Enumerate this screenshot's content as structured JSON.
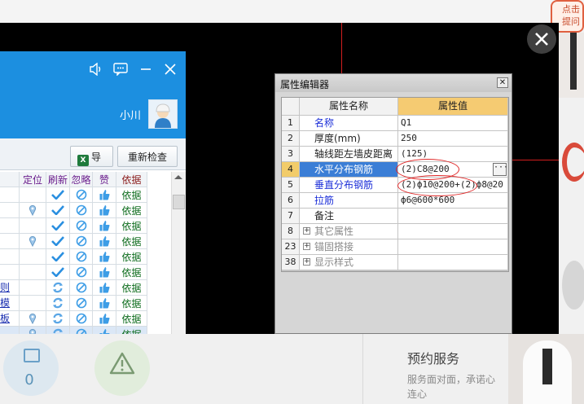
{
  "background_page": {
    "callout_text": "点击提问",
    "count": "0",
    "service_title": "预约服务",
    "service_text": "服务面对面，承诺心连心"
  },
  "viewer": {
    "close_icon": "close-icon"
  },
  "app": {
    "user_name": "小川",
    "toolbar": {
      "export_label": "导出",
      "recheck_label": "重新检查"
    },
    "table": {
      "headers": [
        "定位",
        "刷新",
        "忽略",
        "赞",
        "依据"
      ],
      "rows": [
        {
          "locate": false,
          "refresh": "check",
          "text": ""
        },
        {
          "locate": true,
          "refresh": "check",
          "text": ""
        },
        {
          "locate": false,
          "refresh": "check",
          "text": ""
        },
        {
          "locate": true,
          "refresh": "check",
          "text": ""
        },
        {
          "locate": false,
          "refresh": "check",
          "text": ""
        },
        {
          "locate": false,
          "refresh": "check",
          "text": ""
        },
        {
          "locate": false,
          "refresh": "sync",
          "text": "则模板"
        },
        {
          "locate": false,
          "refresh": "sync",
          "text": ""
        },
        {
          "locate": true,
          "refresh": "sync",
          "text": ""
        },
        {
          "locate": true,
          "refresh": "sync",
          "text": "",
          "selected": true
        }
      ],
      "basis_label": "依据"
    }
  },
  "property_editor": {
    "title": "属性编辑器",
    "col_name": "属性名称",
    "col_value": "属性值",
    "rows": [
      {
        "num": "1",
        "name": "名称",
        "value": "Q1",
        "style": "blue"
      },
      {
        "num": "2",
        "name": "厚度(mm)",
        "value": "250",
        "style": "normal"
      },
      {
        "num": "3",
        "name": "轴线距左墙皮距离",
        "value": "(125)",
        "style": "normal"
      },
      {
        "num": "4",
        "name": "水平分布钢筋",
        "value": "(2)C8@200",
        "style": "selected"
      },
      {
        "num": "5",
        "name": "垂直分布钢筋",
        "value": "(2)ф10@200+(2)ф8@20",
        "style": "blue"
      },
      {
        "num": "6",
        "name": "拉筋",
        "value": "ф6@600*600",
        "style": "blue"
      },
      {
        "num": "7",
        "name": "备注",
        "value": "",
        "style": "normal"
      },
      {
        "num": "8",
        "name": "其它属性",
        "value": "",
        "style": "group"
      },
      {
        "num": "23",
        "name": "锚固搭接",
        "value": "",
        "style": "group"
      },
      {
        "num": "38",
        "name": "显示样式",
        "value": "",
        "style": "group"
      }
    ],
    "ellipsis_label": "···"
  }
}
